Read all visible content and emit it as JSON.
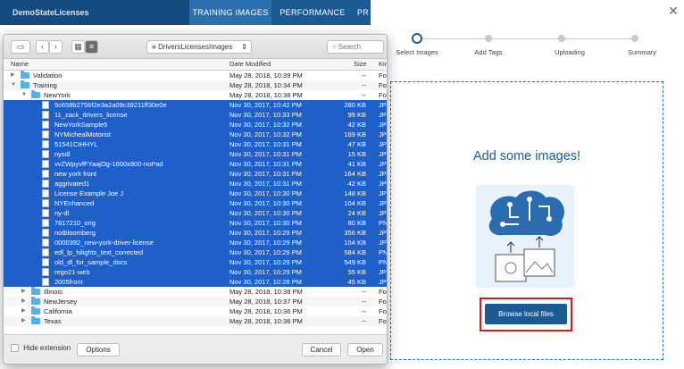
{
  "app": {
    "brand": "DemoStateLicenses",
    "tabs": [
      "TRAINING IMAGES",
      "PERFORMANCE",
      "PR"
    ]
  },
  "wizard": {
    "steps": [
      "Select Images",
      "Add Tags",
      "Uploading",
      "Summary"
    ],
    "title": "Add some images!",
    "browse_label": "Browse local files"
  },
  "dialog": {
    "location": "DriversLicensesImages",
    "search_placeholder": "Search",
    "columns": {
      "name": "Name",
      "date": "Date Modified",
      "size": "Size",
      "kind": "Kin"
    },
    "rows": [
      {
        "name": "Validation",
        "date": "May 28, 2018, 10:39 PM",
        "size": "--",
        "kind": "Fol",
        "type": "folder",
        "level": 0,
        "disc": "▶"
      },
      {
        "name": "Training",
        "date": "May 28, 2018, 10:34 PM",
        "size": "--",
        "kind": "Fol",
        "type": "folder",
        "level": 0,
        "disc": "▼"
      },
      {
        "name": "NewYork",
        "date": "May 28, 2018, 10:38 PM",
        "size": "--",
        "kind": "Fol",
        "type": "folder",
        "level": 1,
        "disc": "▼"
      },
      {
        "name": "5c658b2756f2e3a2a09c39211ff30e0e",
        "date": "Nov 30, 2017, 10:42 PM",
        "size": "280 KB",
        "kind": "JP",
        "type": "file",
        "level": 2,
        "sel": true
      },
      {
        "name": "11_zack_drivers_license",
        "date": "Nov 30, 2017, 10:33 PM",
        "size": "99 KB",
        "kind": "JP",
        "type": "file",
        "level": 2,
        "sel": true
      },
      {
        "name": "NewYorkSample5",
        "date": "Nov 30, 2017, 10:32 PM",
        "size": "42 KB",
        "kind": "JP",
        "type": "file",
        "level": 2,
        "sel": true
      },
      {
        "name": "NYMichealMotorist",
        "date": "Nov 30, 2017, 10:32 PM",
        "size": "169 KB",
        "kind": "JP",
        "type": "file",
        "level": 2,
        "sel": true
      },
      {
        "name": "51541CIHHYL",
        "date": "Nov 30, 2017, 10:31 PM",
        "size": "47 KB",
        "kind": "JP",
        "type": "file",
        "level": 2,
        "sel": true
      },
      {
        "name": "nysdl",
        "date": "Nov 30, 2017, 10:31 PM",
        "size": "15 KB",
        "kind": "JP",
        "type": "file",
        "level": 2,
        "sel": true
      },
      {
        "name": "vvZWpyvfFYaajOg-1600x900-noPad",
        "date": "Nov 30, 2017, 10:31 PM",
        "size": "41 KB",
        "kind": "JP",
        "type": "file",
        "level": 2,
        "sel": true
      },
      {
        "name": "new york front",
        "date": "Nov 30, 2017, 10:31 PM",
        "size": "164 KB",
        "kind": "JP",
        "type": "file",
        "level": 2,
        "sel": true
      },
      {
        "name": "aggrivated1",
        "date": "Nov 30, 2017, 10:31 PM",
        "size": "42 KB",
        "kind": "JP",
        "type": "file",
        "level": 2,
        "sel": true
      },
      {
        "name": "License Example Joe J",
        "date": "Nov 30, 2017, 10:30 PM",
        "size": "148 KB",
        "kind": "JP",
        "type": "file",
        "level": 2,
        "sel": true
      },
      {
        "name": "NYEnhanced",
        "date": "Nov 30, 2017, 10:30 PM",
        "size": "104 KB",
        "kind": "JP",
        "type": "file",
        "level": 2,
        "sel": true
      },
      {
        "name": "ny-dl",
        "date": "Nov 30, 2017, 10:30 PM",
        "size": "24 KB",
        "kind": "JP",
        "type": "file",
        "level": 2,
        "sel": true
      },
      {
        "name": "7817210_orig",
        "date": "Nov 30, 2017, 10:30 PM",
        "size": "80 KB",
        "kind": "PN",
        "type": "file",
        "level": 2,
        "sel": true
      },
      {
        "name": "notbloomberg",
        "date": "Nov 30, 2017, 10:29 PM",
        "size": "356 KB",
        "kind": "JP",
        "type": "file",
        "level": 2,
        "sel": true
      },
      {
        "name": "0000392_new-york-driver-license",
        "date": "Nov 30, 2017, 10:29 PM",
        "size": "104 KB",
        "kind": "JP",
        "type": "file",
        "level": 2,
        "sel": true
      },
      {
        "name": "edl_lp_hilights_text_corrected",
        "date": "Nov 30, 2017, 10:29 PM",
        "size": "584 KB",
        "kind": "PN",
        "type": "file",
        "level": 2,
        "sel": true
      },
      {
        "name": "old_dl_for_sample_docs",
        "date": "Nov 30, 2017, 10:29 PM",
        "size": "549 KB",
        "kind": "PN",
        "type": "file",
        "level": 2,
        "sel": true
      },
      {
        "name": "rego21-web",
        "date": "Nov 30, 2017, 10:29 PM",
        "size": "55 KB",
        "kind": "JP",
        "type": "file",
        "level": 2,
        "sel": true
      },
      {
        "name": "2005front",
        "date": "Nov 30, 2017, 10:28 PM",
        "size": "45 KB",
        "kind": "JP",
        "type": "file",
        "level": 2,
        "sel": true
      },
      {
        "name": "Illinois",
        "date": "May 28, 2018, 10:38 PM",
        "size": "--",
        "kind": "Fol",
        "type": "folder",
        "level": 1,
        "disc": "▶"
      },
      {
        "name": "NewJersey",
        "date": "May 28, 2018, 10:37 PM",
        "size": "--",
        "kind": "Fol",
        "type": "folder",
        "level": 1,
        "disc": "▶"
      },
      {
        "name": "California",
        "date": "May 28, 2018, 10:36 PM",
        "size": "--",
        "kind": "Fol",
        "type": "folder",
        "level": 1,
        "disc": "▶"
      },
      {
        "name": "Texas",
        "date": "May 28, 2018, 10:36 PM",
        "size": "--",
        "kind": "Fol",
        "type": "folder",
        "level": 1,
        "disc": "▶"
      }
    ],
    "footer": {
      "hide_extension": "Hide extension",
      "options": "Options",
      "cancel": "Cancel",
      "open": "Open"
    }
  },
  "colors": {
    "brand": "#1c5a94",
    "selection": "#1e5fc8",
    "highlight": "#e0181e"
  },
  "icons": [
    "close-icon",
    "sidebar-toggle-icon",
    "back-icon",
    "forward-icon",
    "icon-view-icon",
    "list-view-icon",
    "folder-icon",
    "search-icon",
    "brain-circuit-icon",
    "upload-arrow-icon",
    "image-icon"
  ]
}
